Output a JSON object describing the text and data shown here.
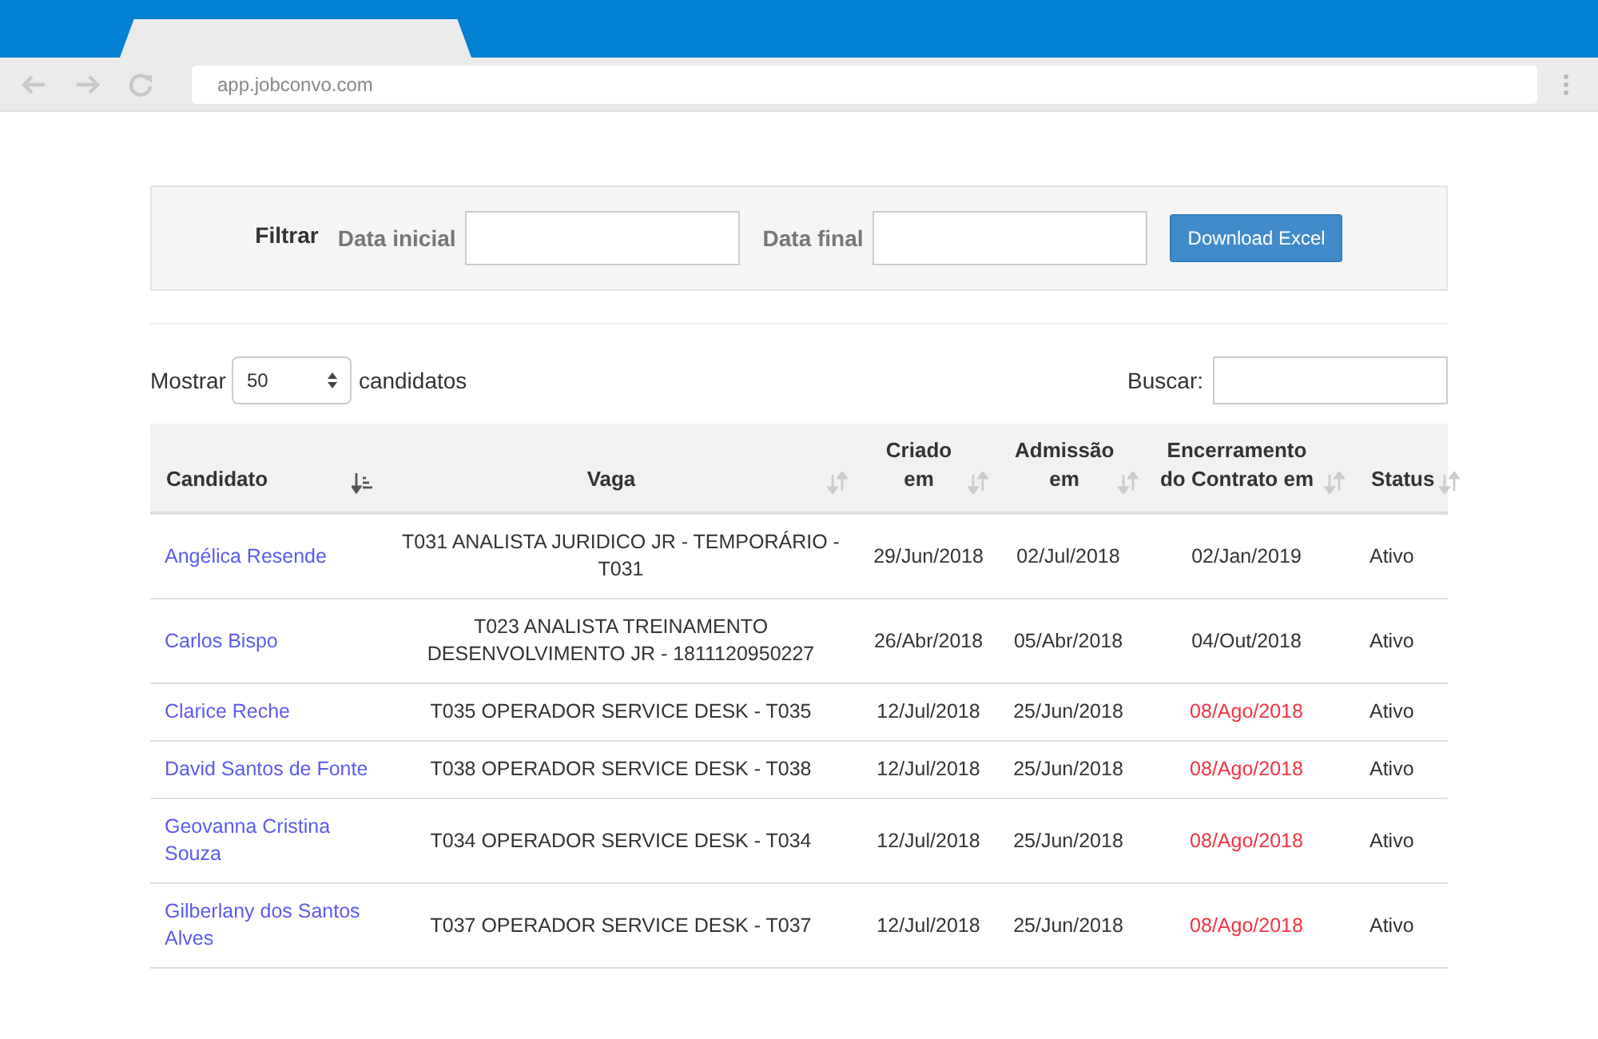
{
  "browser": {
    "url": "app.jobconvo.com"
  },
  "filter": {
    "label": "Filtrar",
    "start_label": "Data inicial",
    "end_label": "Data final",
    "button": "Download Excel"
  },
  "length": {
    "before": "Mostrar",
    "value": "50",
    "after": "candidatos"
  },
  "search": {
    "label": "Buscar:"
  },
  "table": {
    "columns": [
      {
        "label": "Candidato",
        "sorted": true
      },
      {
        "label": "Vaga",
        "sorted": false
      },
      {
        "label": "Criado em",
        "sorted": false
      },
      {
        "label": "Admissão em",
        "sorted": false
      },
      {
        "label": "Encerramento do Contrato em",
        "sorted": false
      },
      {
        "label": "Status",
        "sorted": false
      }
    ],
    "rows": [
      {
        "candidate": "Angélica Resende",
        "job": "T031 ANALISTA JURIDICO JR - TEMPORÁRIO - T031",
        "created": "29/Jun/2018",
        "admission": "02/Jul/2018",
        "end": "02/Jan/2019",
        "overdue": false,
        "status": "Ativo"
      },
      {
        "candidate": "Carlos Bispo",
        "job": "T023 ANALISTA TREINAMENTO DESENVOLVIMENTO JR - 1811120950227",
        "created": "26/Abr/2018",
        "admission": "05/Abr/2018",
        "end": "04/Out/2018",
        "overdue": false,
        "status": "Ativo"
      },
      {
        "candidate": "Clarice Reche",
        "job": "T035 OPERADOR SERVICE DESK - T035",
        "created": "12/Jul/2018",
        "admission": "25/Jun/2018",
        "end": "08/Ago/2018",
        "overdue": true,
        "status": "Ativo"
      },
      {
        "candidate": "David Santos de Fonte",
        "job": "T038 OPERADOR SERVICE DESK - T038",
        "created": "12/Jul/2018",
        "admission": "25/Jun/2018",
        "end": "08/Ago/2018",
        "overdue": true,
        "status": "Ativo"
      },
      {
        "candidate": "Geovanna Cristina Souza",
        "job": "T034 OPERADOR SERVICE DESK - T034",
        "created": "12/Jul/2018",
        "admission": "25/Jun/2018",
        "end": "08/Ago/2018",
        "overdue": true,
        "status": "Ativo"
      },
      {
        "candidate": "Gilberlany dos Santos Alves",
        "job": "T037 OPERADOR SERVICE DESK - T037",
        "created": "12/Jul/2018",
        "admission": "25/Jun/2018",
        "end": "08/Ago/2018",
        "overdue": true,
        "status": "Ativo"
      }
    ]
  }
}
